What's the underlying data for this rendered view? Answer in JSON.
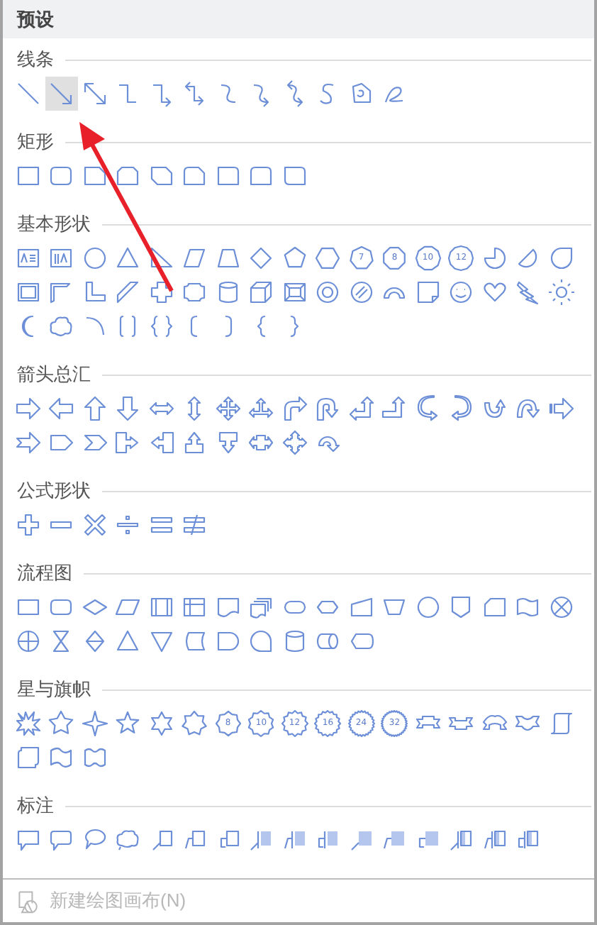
{
  "header": {
    "title": "预设"
  },
  "sections": [
    {
      "kind": "lines",
      "title": "线条",
      "items": [
        {
          "selected": false
        },
        {
          "selected": true
        },
        {
          "selected": false
        },
        {
          "selected": false
        },
        {
          "selected": false
        },
        {
          "selected": false
        },
        {
          "selected": false
        },
        {
          "selected": false
        },
        {
          "selected": false
        },
        {
          "selected": false
        },
        {
          "selected": false
        },
        {
          "selected": false
        }
      ]
    },
    {
      "kind": "rects",
      "title": "矩形",
      "items": [
        {
          "selected": false
        },
        {
          "selected": false
        },
        {
          "selected": false
        },
        {
          "selected": false
        },
        {
          "selected": false
        },
        {
          "selected": false
        },
        {
          "selected": false
        },
        {
          "selected": false
        },
        {
          "selected": false
        }
      ]
    },
    {
      "kind": "basic",
      "title": "基本形状",
      "items": [
        {
          "selected": false
        },
        {
          "selected": false
        },
        {
          "selected": false
        },
        {
          "selected": false
        },
        {
          "selected": false
        },
        {
          "selected": false
        },
        {
          "selected": false
        },
        {
          "selected": false
        },
        {
          "selected": false
        },
        {
          "selected": false
        },
        {
          "selected": false,
          "label": "7"
        },
        {
          "selected": false,
          "label": "8"
        },
        {
          "selected": false,
          "label": "10"
        },
        {
          "selected": false,
          "label": "12"
        },
        {
          "selected": false
        },
        {
          "selected": false
        },
        {
          "selected": false
        },
        {
          "selected": false
        },
        {
          "selected": false
        },
        {
          "selected": false
        },
        {
          "selected": false
        },
        {
          "selected": false
        },
        {
          "selected": false
        },
        {
          "selected": false
        },
        {
          "selected": false
        },
        {
          "selected": false
        },
        {
          "selected": false
        },
        {
          "selected": false
        },
        {
          "selected": false
        },
        {
          "selected": false
        },
        {
          "selected": false
        },
        {
          "selected": false
        },
        {
          "selected": false
        },
        {
          "selected": false
        },
        {
          "selected": false
        },
        {
          "selected": false
        },
        {
          "selected": false
        },
        {
          "selected": false
        },
        {
          "selected": false
        },
        {
          "selected": false
        },
        {
          "selected": false
        },
        {
          "selected": false
        },
        {
          "selected": false
        }
      ]
    },
    {
      "kind": "arrows",
      "title": "箭头总汇",
      "items": [
        {
          "selected": false
        },
        {
          "selected": false
        },
        {
          "selected": false
        },
        {
          "selected": false
        },
        {
          "selected": false
        },
        {
          "selected": false
        },
        {
          "selected": false
        },
        {
          "selected": false
        },
        {
          "selected": false
        },
        {
          "selected": false
        },
        {
          "selected": false
        },
        {
          "selected": false
        },
        {
          "selected": false
        },
        {
          "selected": false
        },
        {
          "selected": false
        },
        {
          "selected": false
        },
        {
          "selected": false
        },
        {
          "selected": false
        },
        {
          "selected": false
        },
        {
          "selected": false
        },
        {
          "selected": false
        },
        {
          "selected": false
        },
        {
          "selected": false
        },
        {
          "selected": false
        },
        {
          "selected": false
        },
        {
          "selected": false
        },
        {
          "selected": false
        }
      ]
    },
    {
      "kind": "equation",
      "title": "公式形状",
      "items": [
        {
          "selected": false
        },
        {
          "selected": false
        },
        {
          "selected": false
        },
        {
          "selected": false
        },
        {
          "selected": false
        },
        {
          "selected": false
        }
      ]
    },
    {
      "kind": "flowchart",
      "title": "流程图",
      "items": [
        {
          "selected": false
        },
        {
          "selected": false
        },
        {
          "selected": false
        },
        {
          "selected": false
        },
        {
          "selected": false
        },
        {
          "selected": false
        },
        {
          "selected": false
        },
        {
          "selected": false
        },
        {
          "selected": false
        },
        {
          "selected": false
        },
        {
          "selected": false
        },
        {
          "selected": false
        },
        {
          "selected": false
        },
        {
          "selected": false
        },
        {
          "selected": false
        },
        {
          "selected": false
        },
        {
          "selected": false
        },
        {
          "selected": false
        },
        {
          "selected": false
        },
        {
          "selected": false
        },
        {
          "selected": false
        },
        {
          "selected": false
        },
        {
          "selected": false
        },
        {
          "selected": false
        },
        {
          "selected": false
        },
        {
          "selected": false
        },
        {
          "selected": false
        },
        {
          "selected": false
        }
      ]
    },
    {
      "kind": "stars",
      "title": "星与旗帜",
      "items": [
        {
          "selected": false
        },
        {
          "selected": false
        },
        {
          "selected": false
        },
        {
          "selected": false
        },
        {
          "selected": false
        },
        {
          "selected": false
        },
        {
          "selected": false,
          "label": "8"
        },
        {
          "selected": false,
          "label": "10"
        },
        {
          "selected": false,
          "label": "12"
        },
        {
          "selected": false,
          "label": "16"
        },
        {
          "selected": false,
          "label": "24"
        },
        {
          "selected": false,
          "label": "32"
        },
        {
          "selected": false
        },
        {
          "selected": false
        },
        {
          "selected": false
        },
        {
          "selected": false
        },
        {
          "selected": false
        },
        {
          "selected": false
        },
        {
          "selected": false
        },
        {
          "selected": false
        }
      ]
    },
    {
      "kind": "callouts",
      "title": "标注",
      "items": [
        {
          "selected": false
        },
        {
          "selected": false
        },
        {
          "selected": false
        },
        {
          "selected": false
        },
        {
          "selected": false
        },
        {
          "selected": false
        },
        {
          "selected": false
        },
        {
          "selected": false
        },
        {
          "selected": false
        },
        {
          "selected": false
        },
        {
          "selected": false
        },
        {
          "selected": false
        },
        {
          "selected": false
        },
        {
          "selected": false
        },
        {
          "selected": false
        },
        {
          "selected": false
        }
      ]
    }
  ],
  "footer": {
    "label": "新建绘图画布(N)",
    "disabled": true
  }
}
